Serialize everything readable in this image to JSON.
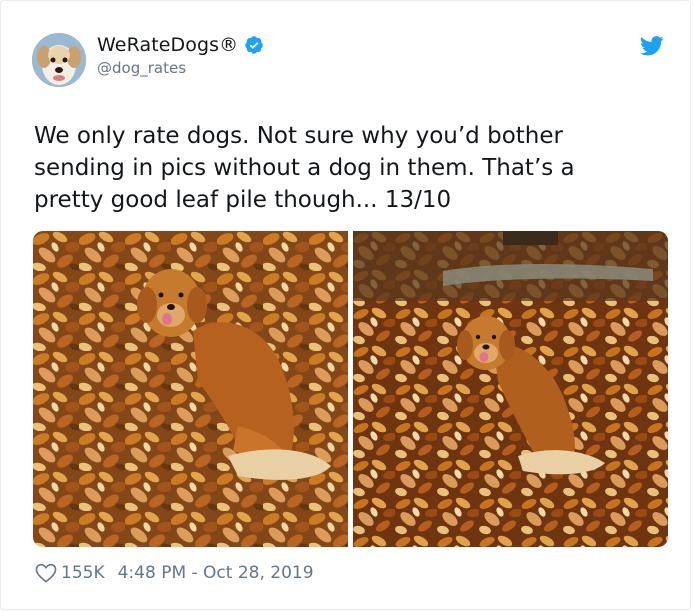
{
  "author": {
    "display_name": "WeRateDogs®",
    "handle": "@dog_rates",
    "verified": true,
    "avatar_icon": "dog-avatar"
  },
  "tweet": {
    "text_lines": [
      "We only rate dogs. Not sure why you’d bother",
      "sending in pics without a dog in them. That’s a",
      "pretty good leaf pile though... 13/10"
    ]
  },
  "media": [
    {
      "description_icon": "golden-retriever-in-leaf-pile-photo"
    },
    {
      "description_icon": "golden-retriever-in-leaf-pile-photo"
    }
  ],
  "footer": {
    "likes": "155K",
    "timestamp": "4:48 PM - Oct 28, 2019"
  },
  "colors": {
    "twitter_blue": "#1da1f2",
    "text_primary": "#14171a",
    "text_secondary": "#657786"
  }
}
